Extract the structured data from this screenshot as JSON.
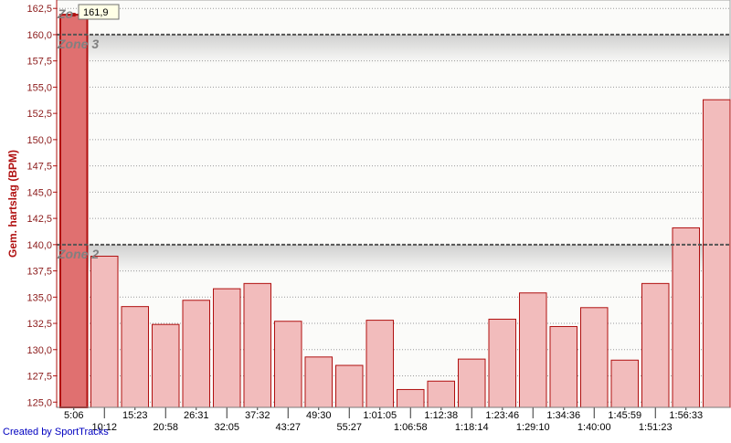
{
  "chart_data": {
    "type": "bar",
    "ylabel": "Gem. hartslag (BPM)",
    "ylim": [
      124.5,
      163.3
    ],
    "yticks": [
      "125,0",
      "127,5",
      "130,0",
      "132,5",
      "135,0",
      "137,5",
      "140,0",
      "142,5",
      "145,0",
      "147,5",
      "150,0",
      "152,5",
      "155,0",
      "157,5",
      "160,0",
      "162,5"
    ],
    "categories_top": [
      "5:06",
      "15:23",
      "26:31",
      "37:32",
      "49:30",
      "1:01:05",
      "1:12:38",
      "1:23:46",
      "1:34:36",
      "1:45:59",
      "1:56:33"
    ],
    "categories_bottom": [
      "10:12",
      "20:58",
      "32:05",
      "43:27",
      "55:27",
      "1:06:58",
      "1:18:14",
      "1:29:10",
      "1:40:00",
      "1:51:23"
    ],
    "values": [
      161.9,
      138.9,
      134.1,
      132.4,
      134.7,
      135.8,
      136.3,
      132.7,
      129.3,
      128.5,
      132.8,
      126.2,
      127.0,
      129.1,
      132.9,
      135.4,
      132.2,
      134.0,
      129.0,
      136.3,
      141.6,
      153.8
    ],
    "highlighted_index": 0,
    "tooltip": "161,9",
    "zones": [
      {
        "label": "Zone 3",
        "value": 160.0
      },
      {
        "label": "Zone 2",
        "value": 140.0
      }
    ],
    "top_zone_label": "Zo",
    "grid": true,
    "colors": {
      "bar_fill": "#f2bcbc",
      "bar_stroke": "#b01010",
      "highlight_fill": "#e07070",
      "axis": "#b01010"
    }
  },
  "footer": {
    "credit": "Created by SportTracks"
  }
}
